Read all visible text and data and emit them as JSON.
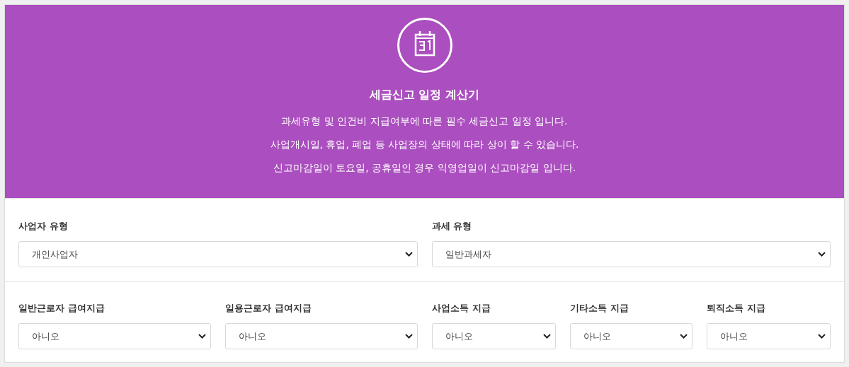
{
  "header": {
    "title": "세금신고 일정 계산기",
    "lines": [
      "과세유형 및 인건비 지급여부에 따른 필수 세금신고 일정 입니다.",
      "사업개시일, 휴업, 폐업 등 사업장의 상태에 따라 상이 할 수 있습니다.",
      "신고마감일이 토요일, 공휴일인 경우 익영업일이 신고마감일 입니다."
    ]
  },
  "sections": [
    {
      "fields": [
        {
          "label": "사업자 유형",
          "value": "개인사업자"
        },
        {
          "label": "과세 유형",
          "value": "일반과세자"
        }
      ]
    },
    {
      "fields": [
        {
          "label": "일반근로자 급여지급",
          "value": "아니오"
        },
        {
          "label": "일용근로자 급여지급",
          "value": "아니오"
        },
        {
          "label": "사업소득 지급",
          "value": "아니오"
        },
        {
          "label": "기타소득 지급",
          "value": "아니오"
        },
        {
          "label": "퇴직소득 지급",
          "value": "아니오"
        }
      ]
    }
  ]
}
